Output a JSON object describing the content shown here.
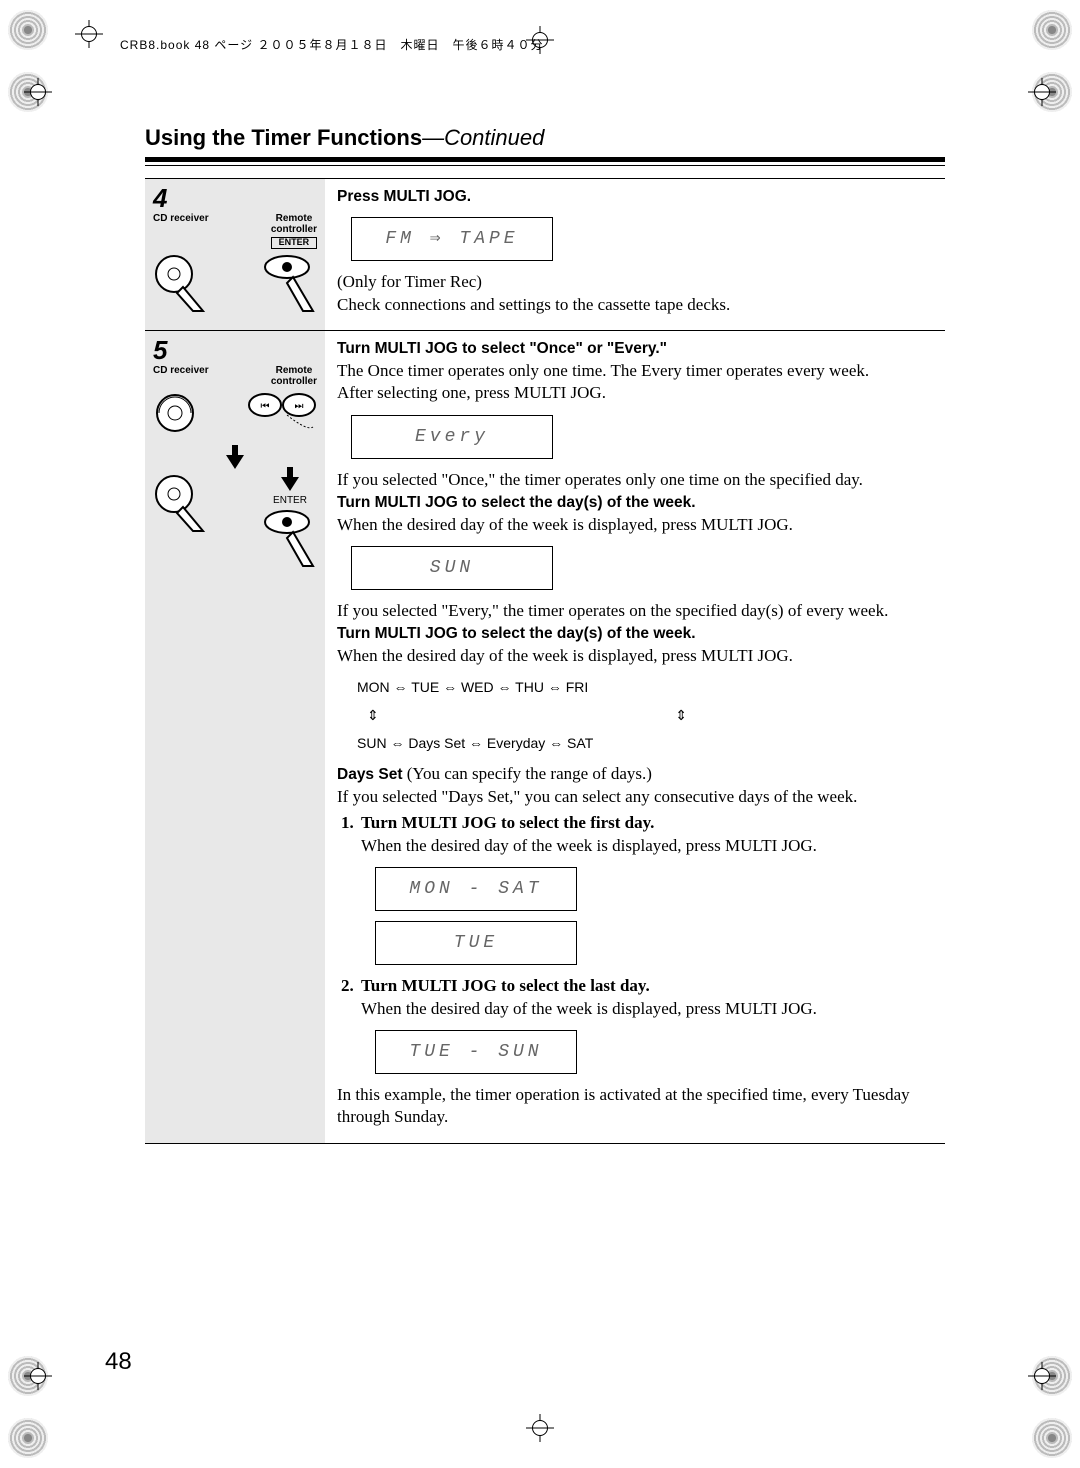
{
  "print_header": "CRB8.book 48 ページ ２００５年８月１８日　木曜日　午後６時４０分",
  "page_number": "48",
  "heading": {
    "title": "Using the Timer Functions",
    "suffix": "—Continued"
  },
  "step4": {
    "num": "4",
    "cdreceiver": "CD receiver",
    "remote": "Remote\ncontroller",
    "enter": "ENTER",
    "h": "Press MULTI JOG.",
    "lcd": "FM  ⇒  TAPE",
    "note1": "(Only for Timer Rec)",
    "note2": "Check connections and settings to the cassette tape decks."
  },
  "step5": {
    "num": "5",
    "cdreceiver": "CD receiver",
    "remote": "Remote\ncontroller",
    "enter": "ENTER",
    "h": "Turn MULTI JOG to select \"Once\" or \"Every.\"",
    "p1": "The Once timer operates only one time. The Every timer operates every week.",
    "p2": "After selecting one, press MULTI JOG.",
    "lcd1": "Every",
    "p3": "If you selected \"Once,\" the timer operates only one time on the specified day.",
    "h2": "Turn MULTI JOG to select the day(s) of the week.",
    "p4": "When the desired day of the week is displayed, press MULTI JOG.",
    "lcd2": "SUN",
    "p5": "If you selected \"Every,\" the timer operates on the specified day(s) of every week.",
    "h3": "Turn MULTI JOG to select the day(s) of the week.",
    "p6": "When the desired day of the week is displayed, press MULTI JOG.",
    "seq_top": "MON  ⇔  TUE  ⇔  WED  ⇔  THU   ⇔  FRI",
    "seq_mid_l": "⇕",
    "seq_mid_r": "⇕",
    "seq_bot": "SUN  ⇔  Days Set  ⇔  Everyday  ⇔   SAT",
    "days_set_lead": "Days Set",
    "days_set_rest": " (You can specify the range of days.)",
    "p7": "If you selected \"Days Set,\" you can select any consecutive days of the week.",
    "li1_hd": "Turn MULTI JOG to select the first day.",
    "li1_tx": "When the desired day of the week is displayed, press MULTI JOG.",
    "lcd3": "MON - SAT",
    "lcd4": "TUE",
    "li2_hd": "Turn MULTI JOG to select the last day.",
    "li2_tx": "When the desired day of the week is displayed, press MULTI JOG.",
    "lcd5": "TUE - SUN",
    "tail": "In this example, the timer operation is activated at the specified time, every Tuesday through Sunday."
  }
}
